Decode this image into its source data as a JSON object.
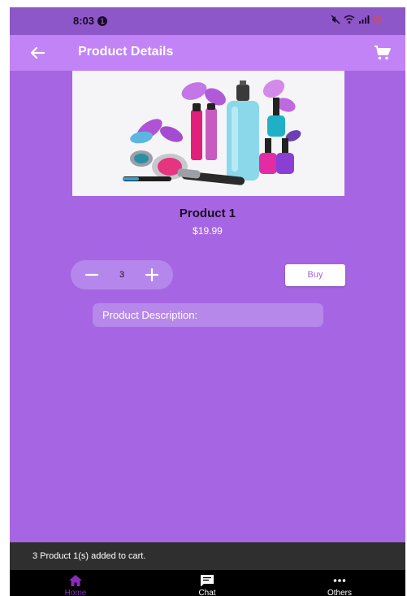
{
  "status_bar": {
    "time": "8:03",
    "notification_badge": "1"
  },
  "app_bar": {
    "title": "Product Details",
    "back_icon": "arrow-left-icon",
    "cart_icon": "shopping-cart-icon"
  },
  "product": {
    "name": "Product 1",
    "price": "$19.99",
    "quantity": "3",
    "buy_label": "Buy",
    "description_label": "Product Description:"
  },
  "snackbar": {
    "message": "3 Product 1(s) added to cart."
  },
  "bottom_nav": {
    "items": [
      {
        "label": "Home",
        "icon": "home-icon",
        "active": true
      },
      {
        "label": "Chat",
        "icon": "chat-icon",
        "active": false
      },
      {
        "label": "Others",
        "icon": "more-icon",
        "active": false
      }
    ]
  },
  "colors": {
    "background": "#a666e3",
    "app_bar": "#c183f5",
    "status_bar": "#8e57c9",
    "active_nav": "#8b2bbd",
    "snackbar": "#2f2f2f"
  }
}
